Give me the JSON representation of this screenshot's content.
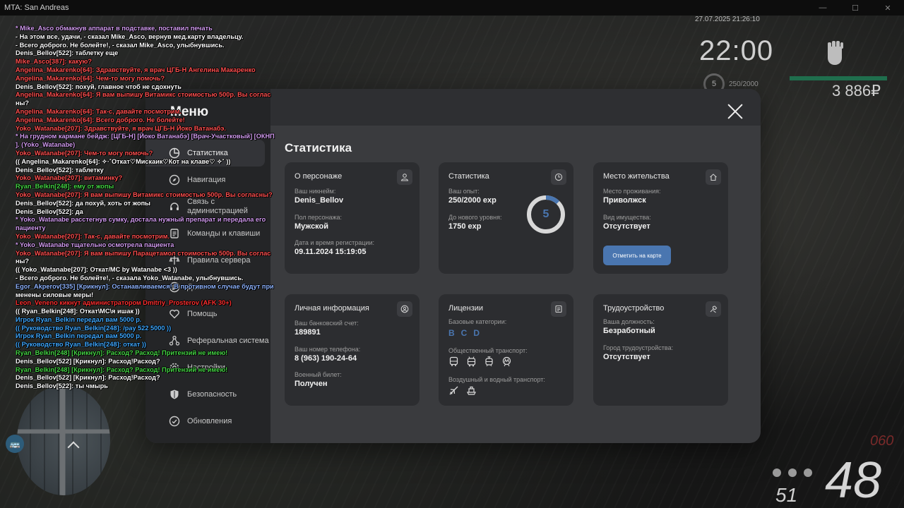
{
  "window": {
    "title": "MTA: San Andreas",
    "controls": [
      "—",
      "☐",
      "✕"
    ]
  },
  "hud": {
    "datetime": "27.07.2025 21:26:10",
    "time": "22:00",
    "level": "5",
    "exp": "250/2000",
    "money": "3 886₽",
    "speed": "48",
    "speed_limit": "060",
    "fuel": "51"
  },
  "chat": [
    {
      "text": "* Mike_Asco обмакнув аппарат в подставке, поставил печать",
      "color": "#d29cf0"
    },
    {
      "text": "- На этом все, удачи, - сказал Mike_Asco, вернув мед.карту владельцу.",
      "color": "#ffffff"
    },
    {
      "text": "- Всего доброго. Не болейте!, - сказал Mike_Asco, улыбнувшись.",
      "color": "#ffffff"
    },
    {
      "text": "Denis_Bellov[522]: таблетку еще",
      "color": "#ffffff"
    },
    {
      "text": "Mike_Asco[387]: какую?",
      "color": "#ff5050"
    },
    {
      "text": "Angelina_Makarenko[64]: Здравствуйте, я врач ЦГБ-Н Ангелина Макаренко",
      "color": "#ff5050"
    },
    {
      "text": "Angelina_Makarenko[64]: Чем-то могу помочь?",
      "color": "#ff5050"
    },
    {
      "text": "Denis_Bellov[522]: похуй, главное чтоб не сдохнуть",
      "color": "#ffffff"
    },
    {
      "text": "Angelina_Makarenko[64]: Я вам выпишу Витамикс стоимостью 500р. Вы соглас",
      "color": "#ff5050"
    },
    {
      "text": "ны?",
      "color": "#ffffff"
    },
    {
      "text": "Angelina_Makarenko[64]: Так-с, давайте посмотрим.",
      "color": "#ff5050"
    },
    {
      "text": "Angelina_Makarenko[64]: Всего доброго. Не болейте!",
      "color": "#ff5050"
    },
    {
      "text": "Yoko_Watanabe[207]: Здравствуйте, я врач ЦГБ-Н Йоко Ватанабэ.",
      "color": "#ff5050"
    },
    {
      "text": "* На грудном кармане бейдж: [ЦГБ-Н] [Йоко Ватанабэ] [Врач-Участковый] [ОКНП",
      "color": "#d29cf0"
    },
    {
      "text": "]. (Yoko_Watanabe)",
      "color": "#d29cf0"
    },
    {
      "text": "Yoko_Watanabe[207]: Чем-то могу помочь?",
      "color": "#ff5050"
    },
    {
      "text": "(( Angelina_Makarenko[64]: ✧·˚Откат♡Мискаик♡Кот на клаве♡ ✧˚ ))",
      "color": "#ffffff"
    },
    {
      "text": "Denis_Bellov[522]: таблетку",
      "color": "#ffffff"
    },
    {
      "text": "Yoko_Watanabe[207]: витаминку?",
      "color": "#ff5050"
    },
    {
      "text": "Ryan_Belkin[248]: ему от жопы",
      "color": "#45d545"
    },
    {
      "text": "Yoko_Watanabe[207]: Я вам выпишу Витамикс стоимостью 500р. Вы согласны?",
      "color": "#ff5050"
    },
    {
      "text": "Denis_Bellov[522]: да похуй, хоть от жопы",
      "color": "#ffffff"
    },
    {
      "text": "Denis_Bellov[522]: да",
      "color": "#ffffff"
    },
    {
      "text": "* Yoko_Watanabe расстегнув сумку, достала нужный препарат и передала его",
      "color": "#d29cf0"
    },
    {
      "text": "пациенту",
      "color": "#d29cf0"
    },
    {
      "text": "Yoko_Watanabe[207]: Так-с, давайте посмотрим.",
      "color": "#ff5050"
    },
    {
      "text": "* Yoko_Watanabe тщательно осмотрела пациента",
      "color": "#d29cf0"
    },
    {
      "text": "Yoko_Watanabe[207]: Я вам выпишу Парацетамол стоимостью 500р. Вы соглас",
      "color": "#ff5050"
    },
    {
      "text": "ны?",
      "color": "#ffffff"
    },
    {
      "text": "(( Yoko_Watanabe[207]: Откат/MC by Watanabe <3 ))",
      "color": "#ffffff"
    },
    {
      "text": "- Всего доброго. Не болейте!, - сказала Yoko_Watanabe, улыбнувшись.",
      "color": "#ffffff"
    },
    {
      "text": "Egor_Akperov[335] [Крикнул]: Останавливаемся! В противном случае будут при",
      "color": "#8fb4ff"
    },
    {
      "text": "менены силовые меры!",
      "color": "#ffffff"
    },
    {
      "text": "Leon_Veneno кикнут администратором Dmitriy_Prosterov (AFK 30+)",
      "color": "#ff3030"
    },
    {
      "text": "(( Ryan_Belkin[248]: Откат\\MC\\я ишак ))",
      "color": "#ffffff"
    },
    {
      "text": "Игрок Ryan_Belkin передал вам 5000 р.",
      "color": "#3fa8ff"
    },
    {
      "text": "(( Руководство Ryan_Belkin[248]: /pay 522 5000 ))",
      "color": "#3fa8ff"
    },
    {
      "text": "Игрок Ryan_Belkin передал вам 5000 р.",
      "color": "#3fa8ff"
    },
    {
      "text": "(( Руководство Ryan_Belkin[248]: откат ))",
      "color": "#3fa8ff"
    },
    {
      "text": "Ryan_Belkin[248] [Крикнул]: Расход? Расход! Притензий не имею!",
      "color": "#45d545"
    },
    {
      "text": "Denis_Bellov[522] [Крикнул]: Расход!Расход?",
      "color": "#ffffff"
    },
    {
      "text": "Ryan_Belkin[248] [Крикнул]: Расход? Расход! Притензий не имею!",
      "color": "#45d545"
    },
    {
      "text": "Denis_Bellov[522] [Крикнул]: Расход!Расход?",
      "color": "#ffffff"
    },
    {
      "text": "Denis_Bellov[522]: ты чмырь",
      "color": "#ffffff"
    }
  ],
  "menu": {
    "title": "Меню",
    "nav": [
      {
        "label": "Статистика",
        "icon": "pie-chart-icon",
        "active": true
      },
      {
        "label": "Навигация",
        "icon": "compass-icon"
      },
      {
        "label": "Связь с администрацией",
        "icon": "headset-icon"
      },
      {
        "label": "Команды и клавиши",
        "icon": "document-icon"
      },
      {
        "label": "Правила сервера",
        "icon": "rules-icon"
      },
      {
        "label": "Донат",
        "icon": "donate-icon"
      },
      {
        "label": "Помощь",
        "icon": "heart-icon"
      },
      {
        "label": "Реферальная система",
        "icon": "referral-icon"
      },
      {
        "label": "Настройки",
        "icon": "gear-icon"
      },
      {
        "label": "Безопасность",
        "icon": "shield-icon"
      },
      {
        "label": "Обновления",
        "icon": "refresh-icon"
      }
    ],
    "content_title": "Статистика",
    "cards": {
      "about": {
        "title": "О персонаже",
        "nick_label": "Ваш никнейм:",
        "nick": "Denis_Bellov",
        "gender_label": "Пол персонажа:",
        "gender": "Мужской",
        "reg_label": "Дата и время регистрации:",
        "reg": "09.11.2024 15:19:05"
      },
      "stats": {
        "title": "Статистика",
        "exp_label": "Ваш опыт:",
        "exp": "250/2000 exp",
        "next_label": "До нового уровня:",
        "next": "1750 exp",
        "level": "5",
        "progress": 0.125
      },
      "residence": {
        "title": "Место жительства",
        "place_label": "Место проживания:",
        "place": "Приволжск",
        "property_label": "Вид имущества:",
        "property": "Отсутствует",
        "map_button": "Отметить на карте"
      },
      "personal": {
        "title": "Личная информация",
        "bank_label": "Ваш банковский счет:",
        "bank": "189891",
        "phone_label": "Ваш номер телефона:",
        "phone": "8 (963) 190-24-64",
        "military_label": "Военный билет:",
        "military": "Получен"
      },
      "licenses": {
        "title": "Лицензии",
        "base_label": "Базовые категории:",
        "base": [
          "B",
          "C",
          "D"
        ],
        "public_label": "Общественный транспорт:",
        "air_label": "Воздушный и водный транспорт:"
      },
      "job": {
        "title": "Трудоустройство",
        "position_label": "Ваша должность:",
        "position": "Безработный",
        "city_label": "Город трудоустройства:",
        "city": "Отсутствует"
      }
    }
  },
  "colors": {
    "accent": "#4a76b0",
    "panel": "#3a3b3e",
    "card": "#2c2d30",
    "sidebar": "#242527"
  }
}
